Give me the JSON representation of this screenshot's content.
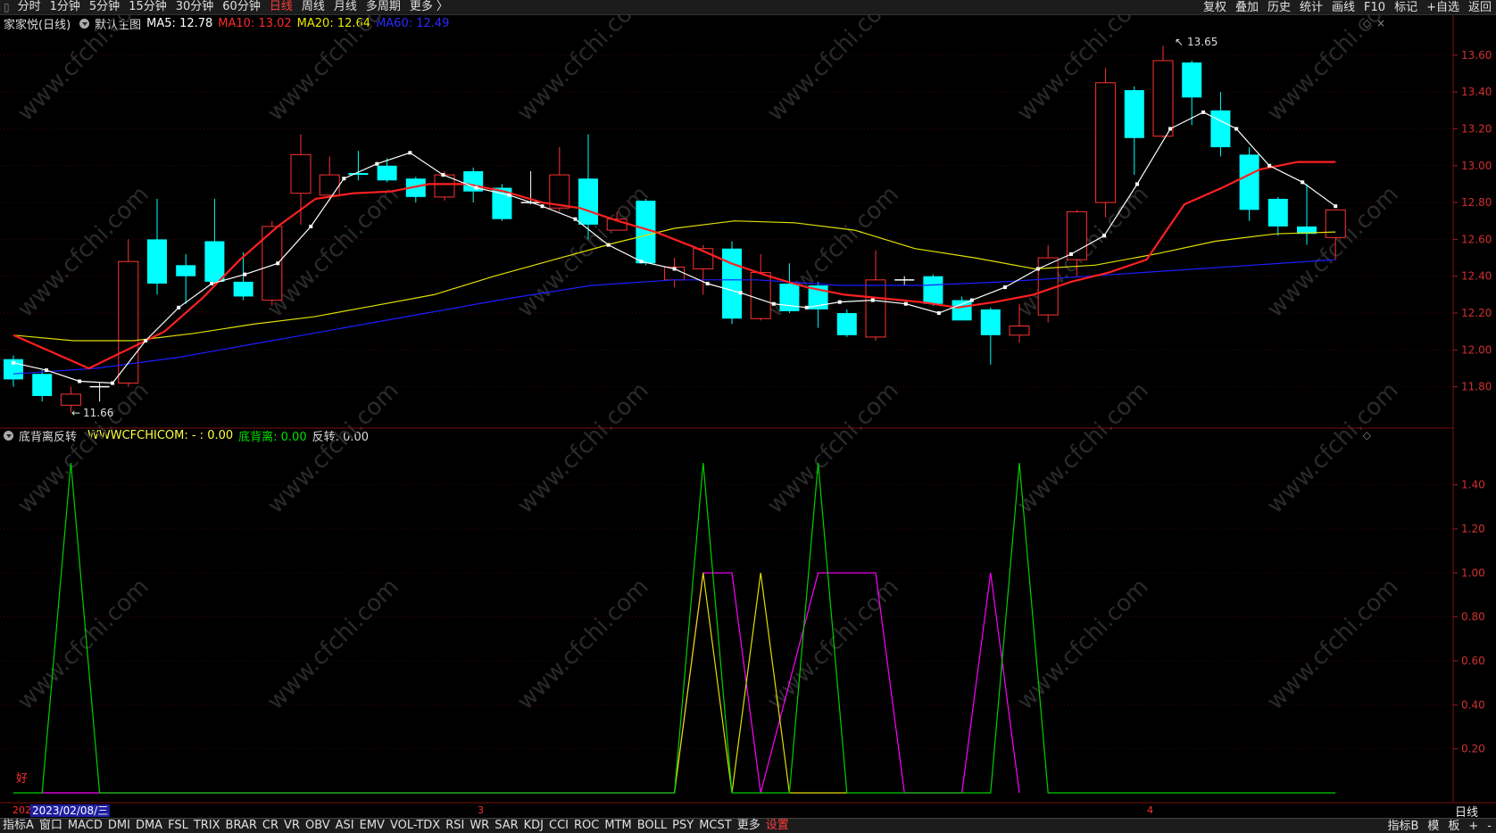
{
  "toolbar": {
    "left_items": [
      "分时",
      "1分钟",
      "5分钟",
      "15分钟",
      "30分钟",
      "60分钟",
      "日线",
      "周线",
      "月线",
      "多周期",
      "更多 〉"
    ],
    "active": "日线",
    "right_items": [
      "复权",
      "叠加",
      "历史",
      "统计",
      "画线",
      "F10",
      "标记",
      "+自选",
      "返回"
    ]
  },
  "main_legend": {
    "stock": "家家悦(日线)",
    "template": "默认主图",
    "ma5": "MA5: 12.78",
    "ma10": "MA10: 13.02",
    "ma20": "MA20: 12.64",
    "ma60": "MA60: 12.49"
  },
  "sub_legend": {
    "name": "底背离反转",
    "www": "WWWCFCHICOM: - : 0.00",
    "dbl": "底背离: 0.00",
    "fz": "反转: 0.00"
  },
  "annotations": {
    "high": "13.65",
    "low": "11.66",
    "date": "2023/02/08/三",
    "good": "好",
    "month3": "3",
    "month4": "4",
    "year_short": "202"
  },
  "axes": {
    "price_ticks": [
      "13.60",
      "13.40",
      "13.20",
      "13.00",
      "12.80",
      "12.60",
      "12.40",
      "12.20",
      "12.00",
      "11.80"
    ],
    "indicator_ticks": [
      "1.40",
      "1.20",
      "1.00",
      "0.80",
      "0.60",
      "0.40",
      "0.20"
    ]
  },
  "bottom_bar": {
    "items": [
      "指标A",
      "窗口",
      "MACD",
      "DMI",
      "DMA",
      "FSL",
      "TRIX",
      "BRAR",
      "CR",
      "VR",
      "OBV",
      "ASI",
      "EMV",
      "VOL-TDX",
      "RSI",
      "WR",
      "SAR",
      "KDJ",
      "CCI",
      "ROC",
      "MTM",
      "BOLL",
      "PSY",
      "MCST",
      "更多",
      "设置"
    ],
    "highlight": "设置",
    "right_items": [
      "指标B",
      "模",
      "板",
      "+",
      "-"
    ]
  },
  "side_label": "日线",
  "watermark": "www.cfchi.com",
  "colors": {
    "up": "#ff3232",
    "down": "#00ffff",
    "ma5": "#ffffff",
    "ma10": "#ff2020",
    "ma20": "#e0e000",
    "ma60": "#1e1eff",
    "green": "#00d000",
    "magenta": "#ff00ff",
    "yellow": "#e0e000"
  },
  "chart_data": {
    "type": "candlestick",
    "price_range": [
      11.6,
      13.72
    ],
    "candles": [
      [
        11.95,
        11.84,
        11.97,
        11.8
      ],
      [
        11.87,
        11.75,
        11.89,
        11.72
      ],
      [
        11.7,
        11.76,
        11.8,
        11.66
      ],
      [
        11.8,
        11.8,
        11.82,
        11.72
      ],
      [
        11.82,
        12.48,
        12.6,
        11.8
      ],
      [
        12.6,
        12.36,
        12.82,
        12.3
      ],
      [
        12.46,
        12.4,
        12.52,
        12.25
      ],
      [
        12.59,
        12.37,
        12.82,
        12.36
      ],
      [
        12.37,
        12.29,
        12.53,
        12.27
      ],
      [
        12.27,
        12.67,
        12.7,
        12.24
      ],
      [
        12.85,
        13.06,
        13.17,
        12.68
      ],
      [
        12.84,
        12.95,
        13.05,
        12.81
      ],
      [
        12.96,
        12.95,
        13.08,
        12.92
      ],
      [
        13.0,
        12.92,
        13.04,
        12.91
      ],
      [
        12.93,
        12.83,
        12.94,
        12.8
      ],
      [
        12.83,
        12.95,
        12.97,
        12.81
      ],
      [
        12.97,
        12.86,
        12.99,
        12.8
      ],
      [
        12.88,
        12.71,
        12.9,
        12.7
      ],
      [
        12.8,
        12.8,
        12.97,
        12.79
      ],
      [
        12.77,
        12.95,
        13.1,
        12.75
      ],
      [
        12.93,
        12.68,
        13.17,
        12.6
      ],
      [
        12.65,
        12.71,
        12.75,
        12.66
      ],
      [
        12.81,
        12.47,
        12.82,
        12.46
      ],
      [
        12.38,
        12.45,
        12.5,
        12.34
      ],
      [
        12.44,
        12.55,
        12.57,
        12.3
      ],
      [
        12.55,
        12.17,
        12.59,
        12.14
      ],
      [
        12.17,
        12.42,
        12.52,
        12.16
      ],
      [
        12.36,
        12.21,
        12.47,
        12.2
      ],
      [
        12.35,
        12.22,
        12.37,
        12.12
      ],
      [
        12.2,
        12.08,
        12.22,
        12.07
      ],
      [
        12.07,
        12.38,
        12.54,
        12.05
      ],
      [
        12.38,
        12.38,
        12.4,
        12.35
      ],
      [
        12.4,
        12.25,
        12.41,
        12.24
      ],
      [
        12.27,
        12.16,
        12.29,
        12.16
      ],
      [
        12.22,
        12.08,
        12.23,
        11.92
      ],
      [
        12.08,
        12.13,
        12.25,
        12.04
      ],
      [
        12.19,
        12.5,
        12.57,
        12.15
      ],
      [
        12.49,
        12.75,
        12.76,
        12.4
      ],
      [
        12.8,
        13.45,
        13.53,
        12.72
      ],
      [
        13.41,
        13.15,
        13.43,
        12.95
      ],
      [
        13.16,
        13.57,
        13.65,
        13.15
      ],
      [
        13.56,
        13.37,
        13.57,
        13.22
      ],
      [
        13.3,
        13.1,
        13.4,
        13.05
      ],
      [
        13.06,
        12.76,
        13.1,
        12.7
      ],
      [
        12.82,
        12.67,
        12.83,
        12.62
      ],
      [
        12.67,
        12.63,
        12.9,
        12.57
      ],
      [
        12.61,
        12.76,
        12.76,
        12.49
      ]
    ],
    "ma5": [
      11.93,
      11.89,
      11.83,
      11.82,
      12.05,
      12.23,
      12.36,
      12.41,
      12.47,
      12.67,
      12.93,
      13.01,
      13.07,
      12.95,
      12.88,
      12.84,
      12.78,
      12.71,
      12.57,
      12.48,
      12.44,
      12.36,
      12.31,
      12.25,
      12.23,
      12.26,
      12.27,
      12.25,
      12.2,
      12.27,
      12.34,
      12.44,
      12.52,
      12.62,
      12.9,
      13.2,
      13.29,
      13.2,
      13.0,
      12.91,
      12.78
    ],
    "ma10": [
      12.08,
      11.99,
      11.9,
      12.0,
      12.1,
      12.28,
      12.49,
      12.67,
      12.82,
      12.85,
      12.86,
      12.9,
      12.9,
      12.86,
      12.8,
      12.77,
      12.7,
      12.64,
      12.56,
      12.47,
      12.4,
      12.34,
      12.3,
      12.28,
      12.26,
      12.23,
      12.26,
      12.3,
      12.37,
      12.42,
      12.49,
      12.79,
      12.88,
      12.98,
      13.02,
      13.02
    ],
    "ma20": [
      12.08,
      12.05,
      12.05,
      12.09,
      12.14,
      12.18,
      12.24,
      12.3,
      12.4,
      12.49,
      12.58,
      12.66,
      12.7,
      12.69,
      12.65,
      12.55,
      12.5,
      12.44,
      12.46,
      12.52,
      12.59,
      12.63,
      12.64
    ],
    "ma60": [
      11.87,
      11.9,
      11.96,
      12.04,
      12.12,
      12.2,
      12.28,
      12.35,
      12.38,
      12.38,
      12.35,
      12.35,
      12.37,
      12.4,
      12.43,
      12.46,
      12.49
    ],
    "indicator": {
      "range": [
        0,
        1.5
      ],
      "green": [
        [
          0,
          0
        ],
        [
          1,
          0
        ],
        [
          2,
          1.5
        ],
        [
          3,
          0
        ],
        [
          23,
          0
        ],
        [
          24,
          1.5
        ],
        [
          25,
          0
        ],
        [
          27,
          0
        ],
        [
          28,
          1.5
        ],
        [
          29,
          0
        ],
        [
          34,
          0
        ],
        [
          35,
          1.5
        ],
        [
          36,
          0
        ],
        [
          46,
          0
        ]
      ],
      "magenta": [
        [
          1,
          0
        ],
        [
          3,
          0
        ],
        [
          23,
          0
        ],
        [
          24,
          1
        ],
        [
          25,
          1
        ],
        [
          26,
          0
        ],
        [
          28,
          1
        ],
        [
          30,
          1
        ],
        [
          31,
          0
        ],
        [
          33,
          0
        ],
        [
          34,
          1
        ],
        [
          35,
          0
        ]
      ],
      "yellow": [
        [
          23,
          0
        ],
        [
          24,
          1
        ],
        [
          25,
          0
        ],
        [
          26,
          1
        ],
        [
          27,
          0
        ],
        [
          29,
          0
        ]
      ]
    }
  }
}
